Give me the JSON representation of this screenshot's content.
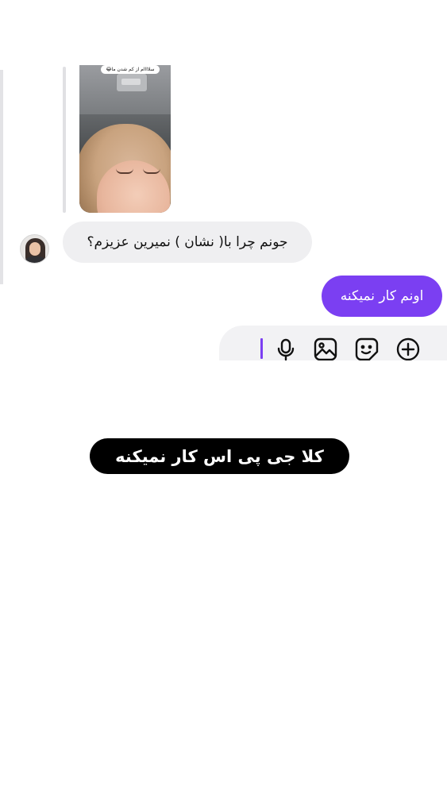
{
  "story_reply": {
    "caption_text": "سلاااام از کم شدن ما😂"
  },
  "messages": [
    {
      "sender": "contact",
      "text": "جونم چرا با( نشان ) نمیرین عزیزم؟"
    },
    {
      "sender": "me",
      "text": "اونم کار نمیکنه"
    }
  ],
  "composer": {
    "icons": [
      "microphone-icon",
      "gallery-icon",
      "sticker-icon",
      "add-icon"
    ]
  },
  "overlay_caption": "کلا جی پی اس کار نمیکنه",
  "colors": {
    "accent": "#7b3ff2",
    "incoming_bubble": "#efeff1",
    "caption_bg": "#000000"
  }
}
